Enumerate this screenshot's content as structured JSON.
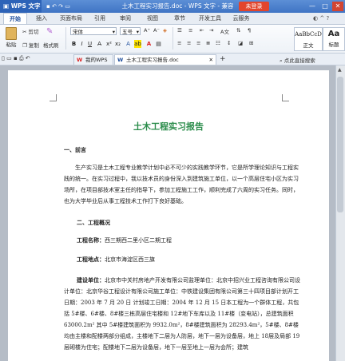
{
  "titlebar": {
    "app_name": "WPS 文字",
    "doc_title": "土木工程实习报告.doc - WPS 文字 - 兼容模式",
    "login_label": "未登录",
    "minimize": "—",
    "maximize": "□",
    "close": "✕"
  },
  "tabs": [
    "开始",
    "插入",
    "页面布局",
    "引用",
    "审阅",
    "视图",
    "章节",
    "开发工具",
    "云服务"
  ],
  "ribbon": {
    "paste": "粘贴",
    "cut": "剪切",
    "copy": "复制",
    "format_painter": "格式刷",
    "font_name": "宋体",
    "font_size": "五号",
    "style_sample": "AaBbCcD",
    "style_normal": "正文",
    "style_heading": "标题",
    "style_heading_sample": "Aa"
  },
  "quickbar": {
    "tab1_label": "我的WPS",
    "tab2_label": "土木工程实习报告.doc",
    "new_tab": "+",
    "search_hint": "点此直接搜索"
  },
  "document": {
    "title": "土木工程实习报告",
    "section1_heading": "一、前言",
    "section1_para": "生产实习是土木工程专业教学计划中必不可少的实践教学环节，它是所学理论知识与工程实践的统一。在实习过程中，我以技术员的身份深入到建筑施工单位，以一个高层住宅小区为实习场所，在项目部技术室主任的指导下，参加工程施工工作，顺利完成了六周的实习任务。同时，也为大学毕业后从事工程技术工作打下良好基础。",
    "section2_heading": "二、工程概况",
    "name_label": "工程名称：",
    "name_value": "西三期西二里小区二期工程",
    "location_label": "工程地点：",
    "location_value": "北京市海淀区西三旗",
    "builder_label": "建设单位：",
    "builder_text": "北京市中关村房地产开发有限公司监理单位：北京中招兴业工程咨询有限公司设计单位：北京华谷工程设计有限公司施工单位：中铁建设集团有限公司第三十四项目部计划开工日期：2003 年 7 月 20 日 计划竣工日期：2004 年 12 月 15 日本工程为一个群体工程，共包括 5#楼、6#楼、8#楼三栋高层住宅楼和 12#地下车库以及 11#楼（变电站），总建筑面积 63000.2m² 其中 5#楼建筑面积为 9932.0m²，8#楼建筑面积为 28293.4m²，5#楼、8#楼均由主楼和配楼两部分组成，主楼地下二层为人防层，地下一层为设备层，地上 18层及局部 19层砌楼为住宅；配楼地下二层为设备层，地下一层至地上一层为会所；建筑"
  }
}
